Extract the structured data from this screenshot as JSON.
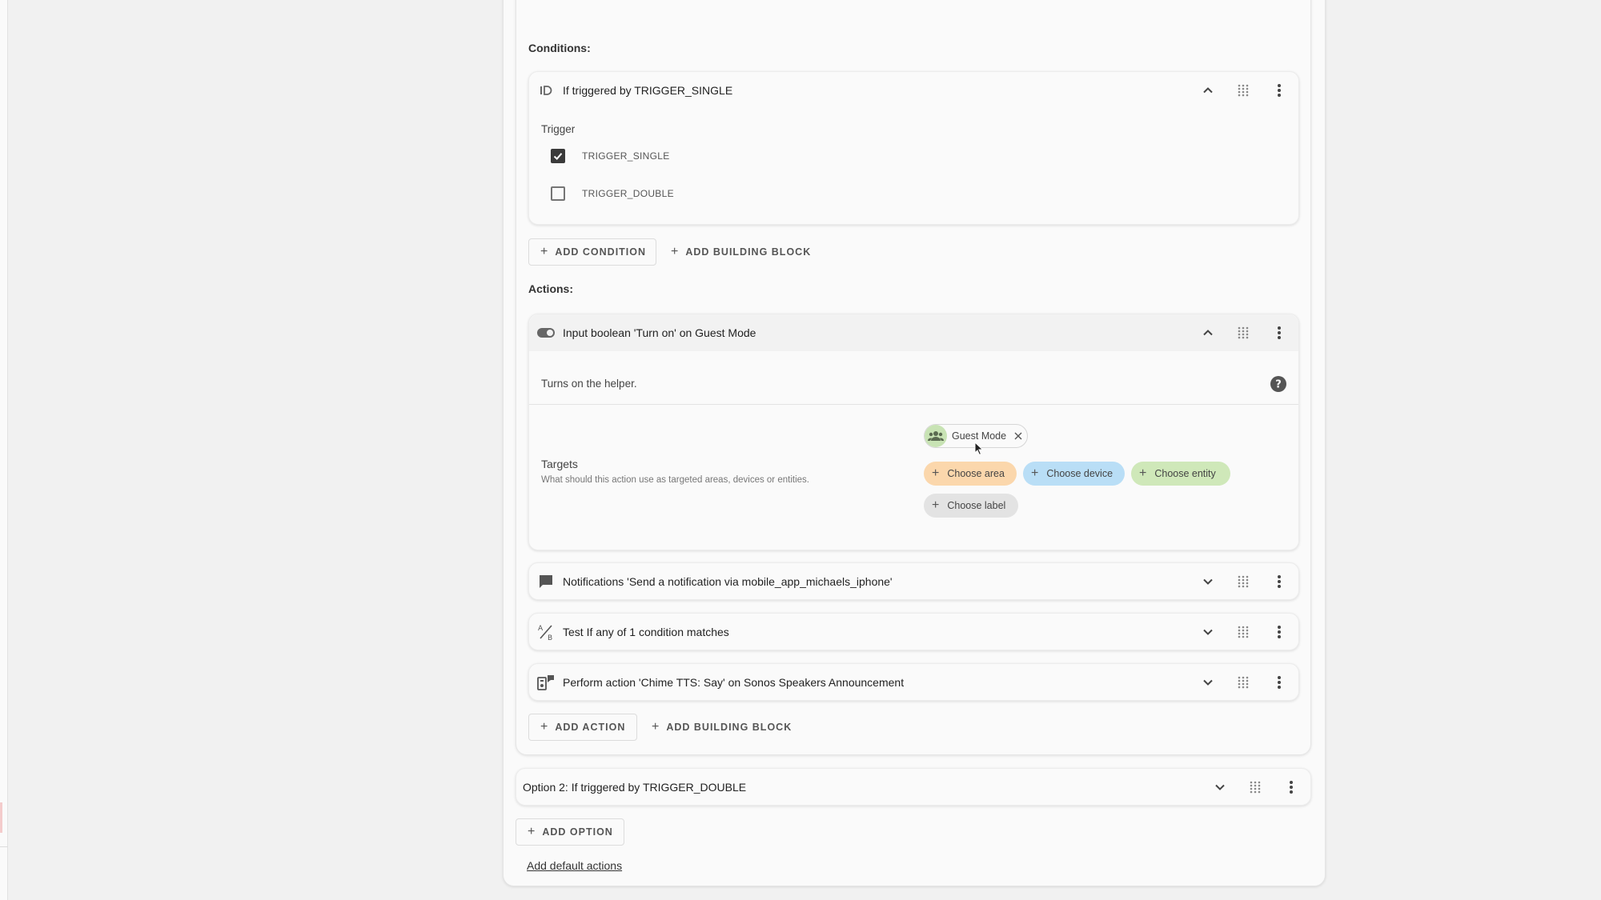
{
  "conditions": {
    "heading": "Conditions:",
    "card": {
      "title": "If triggered by TRIGGER_SINGLE",
      "trigger_label": "Trigger",
      "options": [
        {
          "label": "TRIGGER_SINGLE",
          "checked": true
        },
        {
          "label": "TRIGGER_DOUBLE",
          "checked": false
        }
      ]
    },
    "add_condition": "ADD CONDITION",
    "add_building_block": "ADD BUILDING BLOCK"
  },
  "actions": {
    "heading": "Actions:",
    "expanded": {
      "title": "Input boolean 'Turn on' on Guest Mode",
      "description": "Turns on the helper.",
      "targets_label": "Targets",
      "targets_hint": "What should this action use as targeted areas, devices or entities.",
      "selected_chip": "Guest Mode",
      "choose_area": "Choose area",
      "choose_device": "Choose device",
      "choose_entity": "Choose entity",
      "choose_label": "Choose label"
    },
    "collapsed": [
      {
        "title": "Notifications 'Send a notification via mobile_app_michaels_iphone'",
        "icon": "message-icon"
      },
      {
        "title": "Test If any of 1 condition matches",
        "icon": "ab-test-icon"
      },
      {
        "title": "Perform action 'Chime TTS: Say' on Sonos Speakers Announcement",
        "icon": "service-icon"
      }
    ],
    "add_action": "ADD ACTION",
    "add_building_block": "ADD BUILDING BLOCK"
  },
  "option2": {
    "title": "Option 2: If triggered by TRIGGER_DOUBLE"
  },
  "add_option": "ADD OPTION",
  "add_default_actions": "Add default actions",
  "colors": {
    "area_chip": "#fbd7ac",
    "device_chip": "#b9def6",
    "entity_chip": "#cfe8b9",
    "label_chip": "#e3e3e3",
    "entity_chip_avatar": "#c8e3b4"
  }
}
